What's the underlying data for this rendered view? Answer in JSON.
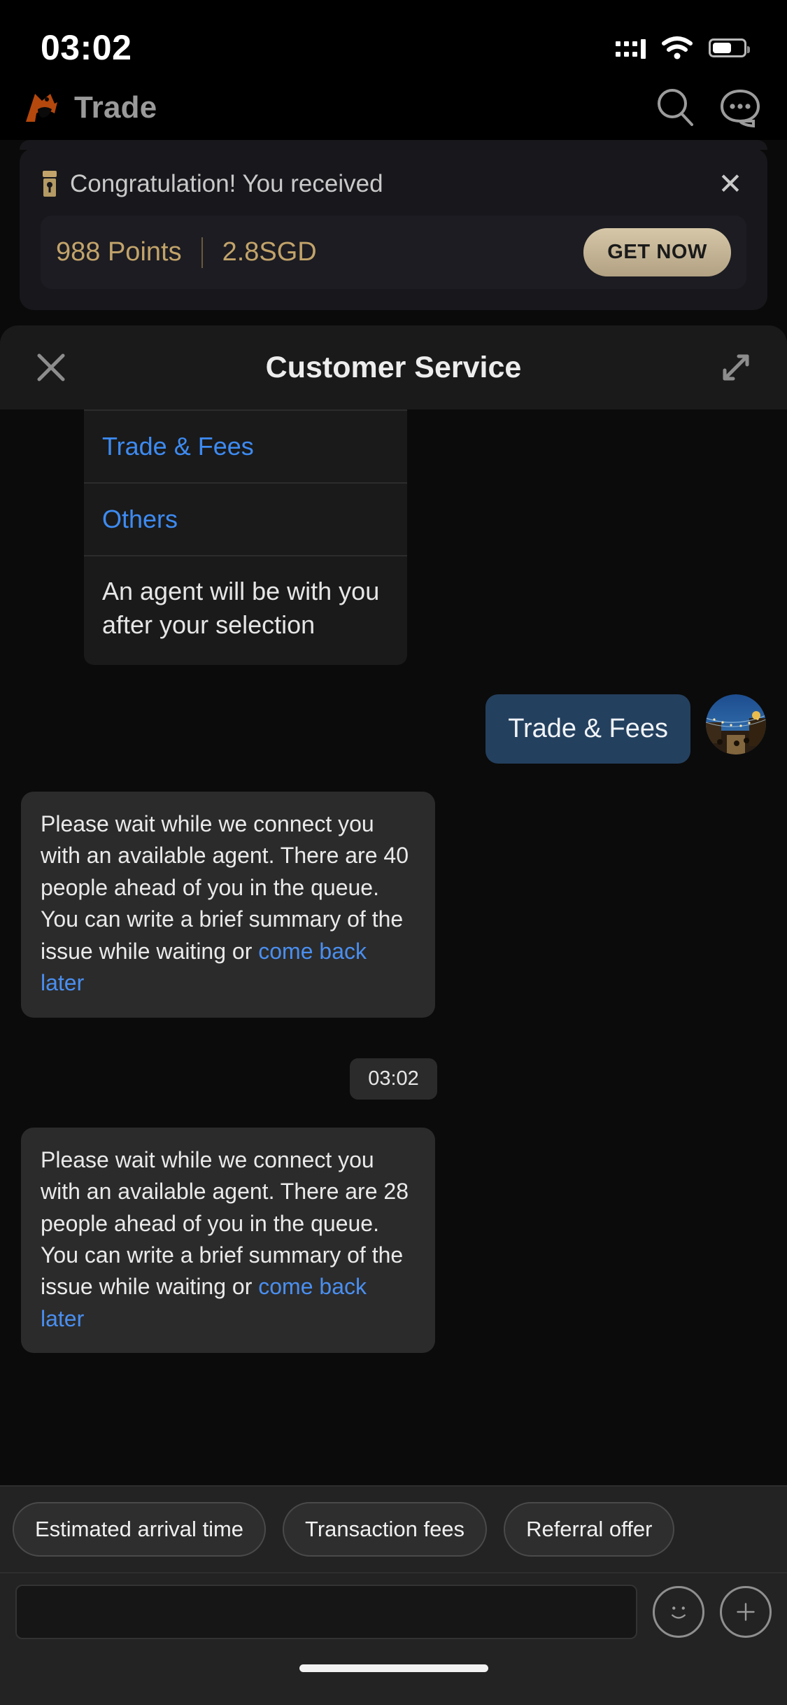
{
  "status_bar": {
    "time": "03:02",
    "signal_icon": "cellular-signal-icon",
    "wifi_icon": "wifi-icon",
    "battery_icon": "battery-icon"
  },
  "app_header": {
    "logo_icon": "bull-logo-icon",
    "title": "Trade",
    "search_icon": "search-icon",
    "support_chat_icon": "chat-bubble-dots-icon"
  },
  "promo_banner": {
    "gift_icon": "gift-box-icon",
    "title": "Congratulation! You received",
    "close_icon": "close-icon",
    "points": "988 Points",
    "amount": "2.8SGD",
    "cta_label": "GET NOW",
    "accent_color": "#c2a36a"
  },
  "sheet": {
    "title": "Customer Service",
    "close_icon": "close-icon",
    "expand_icon": "expand-diagonal-icon"
  },
  "chat": {
    "menu_card": {
      "options": [
        {
          "label": "Trade & Fees"
        },
        {
          "label": "Others"
        }
      ],
      "note": "An agent will be with you after your selection",
      "link_color": "#3d8bf2"
    },
    "messages": [
      {
        "type": "outgoing",
        "text": "Trade & Fees",
        "avatar_icon": "user-avatar-photo",
        "bubble_color": "#24405f"
      },
      {
        "type": "incoming",
        "text_before_link": "Please wait while we connect you with an available agent. There are 40 people ahead of you in the queue. You can write a brief summary of the issue while waiting or ",
        "link_text": "come back later",
        "queue_count": "40"
      },
      {
        "type": "timestamp",
        "text": "03:02"
      },
      {
        "type": "incoming",
        "text_before_link": "Please wait while we connect you with an available agent. There are 28 people ahead of you in the queue. You can write a brief summary of the issue while waiting or ",
        "link_text": "come back later",
        "queue_count": "28"
      }
    ]
  },
  "quick_replies": [
    {
      "label": "Estimated arrival time"
    },
    {
      "label": "Transaction fees"
    },
    {
      "label": "Referral offer"
    }
  ],
  "composer": {
    "value": "",
    "placeholder": "",
    "emoji_icon": "smiley-face-icon",
    "attach_icon": "plus-circle-icon"
  },
  "home_indicator": "home-indicator-bar"
}
